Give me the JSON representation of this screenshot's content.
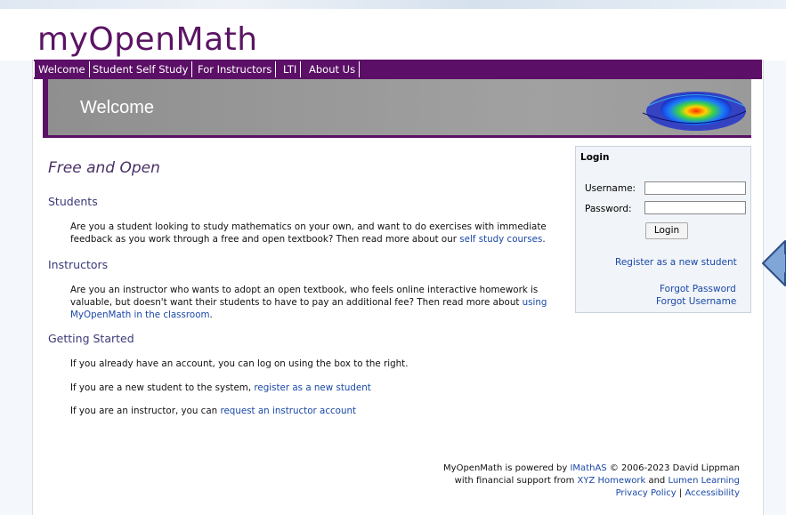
{
  "brand": {
    "logo_text": "myOpenMath"
  },
  "nav": {
    "items": [
      {
        "label": "Welcome"
      },
      {
        "label": "Student Self Study"
      },
      {
        "label": "For Instructors"
      },
      {
        "label": "LTI"
      },
      {
        "label": "About Us"
      }
    ]
  },
  "banner": {
    "title": "Welcome"
  },
  "main": {
    "heading": "Free and Open",
    "students": {
      "title": "Students",
      "text": "Are you a student looking to study mathematics on your own, and want to do exercises with immediate feedback as you work through a free and open textbook? Then read more about our ",
      "link": "self study courses",
      "end": "."
    },
    "instructors": {
      "title": "Instructors",
      "text": "Are you an instructor who wants to adopt an open textbook, who feels online interactive homework is valuable, but doesn't want their students to have to pay an additional fee? Then read more about ",
      "link": "using MyOpenMath in the classroom",
      "end": "."
    },
    "getting_started": {
      "title": "Getting Started",
      "line1": "If you already have an account, you can log on using the box to the right.",
      "line2_text": "If you are a new student to the system, ",
      "line2_link": "register as a new student",
      "line3_text": "If you are an instructor, you can ",
      "line3_link": "request an instructor account"
    }
  },
  "login": {
    "title": "Login",
    "username_label": "Username:",
    "password_label": "Password:",
    "username_value": "",
    "password_value": "",
    "button": "Login",
    "register": "Register as a new student",
    "forgot_password": "Forgot Password",
    "forgot_username": "Forgot Username"
  },
  "footer": {
    "powered_prefix": "MyOpenMath is powered by ",
    "imathas": "IMathAS",
    "powered_suffix": " © 2006-2023 David Lippman",
    "support_prefix": "with financial support from ",
    "xyz": "XYZ Homework",
    "and": " and ",
    "lumen": "Lumen Learning",
    "privacy": "Privacy Policy",
    "sep": " | ",
    "accessibility": "Accessibility"
  },
  "colors": {
    "brand_purple": "#5b0f66",
    "link_blue": "#1a48a8",
    "arrow_blue": "#7fa6d6"
  },
  "icons": {
    "arrow": "left-arrow-icon",
    "banner_art": "surface-plot-image"
  }
}
